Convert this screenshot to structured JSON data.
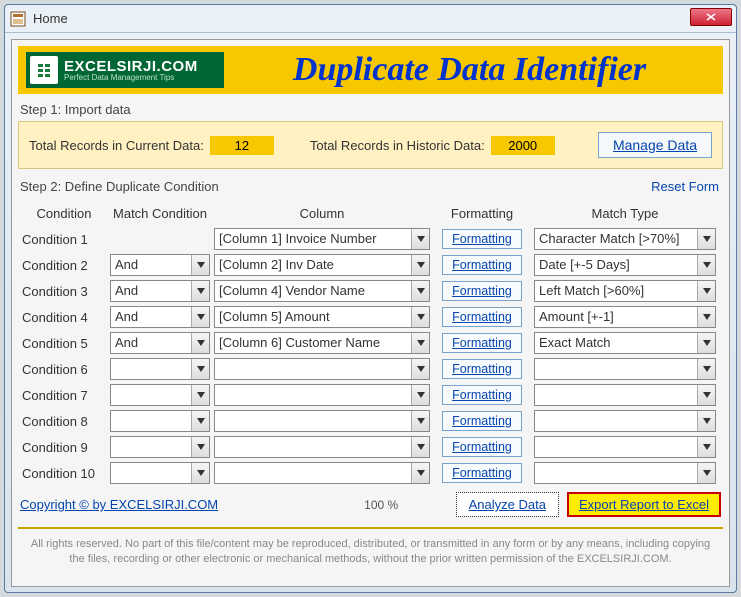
{
  "window": {
    "title": "Home"
  },
  "header": {
    "logo_main": "EXCELSIRJI.COM",
    "logo_sub": "Perfect Data Management Tips",
    "app_title": "Duplicate Data Identifier"
  },
  "step1": {
    "label": "Step 1: Import data",
    "current_label": "Total Records in Current Data:",
    "current_value": "12",
    "historic_label": "Total Records in Historic Data:",
    "historic_value": "2000",
    "manage_btn": "Manage Data"
  },
  "step2": {
    "label": "Step 2: Define Duplicate Condition",
    "reset": "Reset Form",
    "headers": {
      "condition": "Condition",
      "match": "Match Condition",
      "column": "Column",
      "formatting": "Formatting",
      "type": "Match Type"
    },
    "fmt_btn": "Formatting",
    "rows": [
      {
        "label": "Condition 1",
        "match": "",
        "column": "[Column 1] Invoice Number",
        "type": "Character Match [>70%]"
      },
      {
        "label": "Condition 2",
        "match": "And",
        "column": "[Column 2] Inv Date",
        "type": "Date [+-5 Days]"
      },
      {
        "label": "Condition 3",
        "match": "And",
        "column": "[Column 4] Vendor Name",
        "type": "Left Match [>60%]"
      },
      {
        "label": "Condition 4",
        "match": "And",
        "column": "[Column 5] Amount",
        "type": "Amount [+-1]"
      },
      {
        "label": "Condition 5",
        "match": "And",
        "column": "[Column 6] Customer Name",
        "type": "Exact Match"
      },
      {
        "label": "Condition 6",
        "match": "",
        "column": "",
        "type": ""
      },
      {
        "label": "Condition 7",
        "match": "",
        "column": "",
        "type": ""
      },
      {
        "label": "Condition 8",
        "match": "",
        "column": "",
        "type": ""
      },
      {
        "label": "Condition 9",
        "match": "",
        "column": "",
        "type": ""
      },
      {
        "label": "Condition 10",
        "match": "",
        "column": "",
        "type": ""
      }
    ]
  },
  "bottom": {
    "copyright": "Copyright © by EXCELSIRJI.COM",
    "pct": "100 %",
    "analyze": "Analyze Data",
    "export": "Export Report to Excel"
  },
  "footer": "All rights reserved. No part of this file/content may be reproduced, distributed, or transmitted in any form or by any means, including copying the files, recording or other electronic or mechanical methods, without the prior written permission of the EXCELSIRJI.COM."
}
